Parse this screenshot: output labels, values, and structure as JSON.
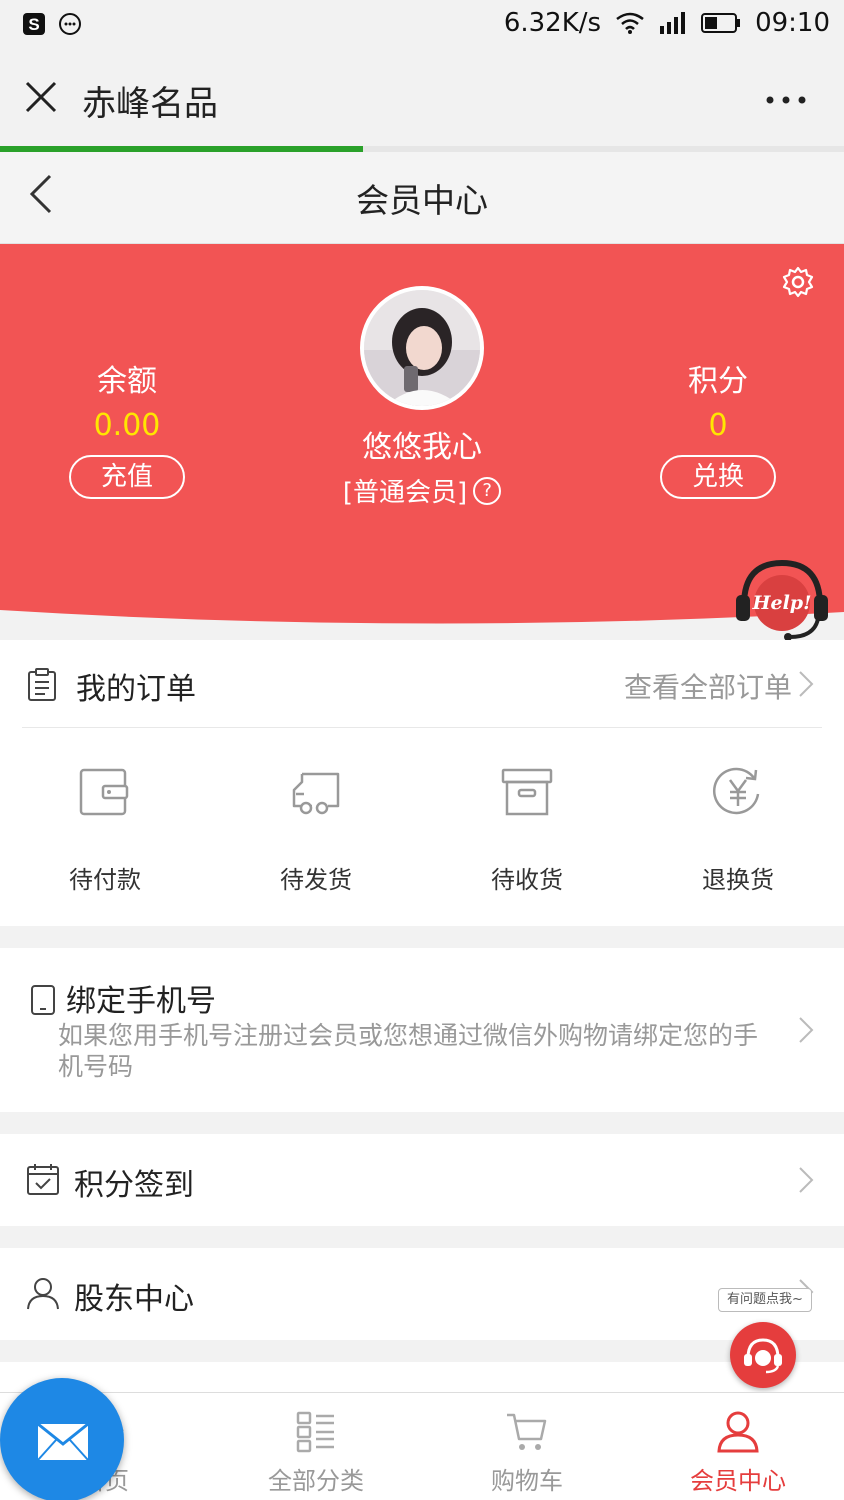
{
  "status_bar": {
    "speed": "6.32K/s",
    "time": "09:10"
  },
  "wechat": {
    "title": "赤峰名品",
    "load_progress": 0.43
  },
  "page": {
    "title": "会员中心"
  },
  "member": {
    "balance_label": "余额",
    "balance_value": "0.00",
    "recharge_label": "充值",
    "points_label": "积分",
    "points_value": "0",
    "exchange_label": "兑换",
    "username": "悠悠我心",
    "level": "[普通会员]",
    "help_badge": "Help!"
  },
  "orders": {
    "title": "我的订单",
    "view_all": "查看全部订单",
    "statuses": [
      {
        "label": "待付款",
        "icon": "wallet-icon"
      },
      {
        "label": "待发货",
        "icon": "truck-icon"
      },
      {
        "label": "待收货",
        "icon": "box-icon"
      },
      {
        "label": "退换货",
        "icon": "yen-refund-icon"
      }
    ]
  },
  "bind_phone": {
    "title": "绑定手机号",
    "desc": "如果您用手机号注册过会员或您想通过微信外购物请绑定您的手机号码"
  },
  "points_signin": {
    "title": "积分签到"
  },
  "shareholder": {
    "title": "股东中心"
  },
  "service_tip": "有问题点我~",
  "tabs": [
    {
      "label": "首页",
      "icon": "home-icon"
    },
    {
      "label": "全部分类",
      "icon": "category-icon"
    },
    {
      "label": "购物车",
      "icon": "cart-icon"
    },
    {
      "label": "会员中心",
      "icon": "user-icon",
      "active": true
    }
  ],
  "colors": {
    "brand_red": "#f25454",
    "accent_yellow": "#ffe600",
    "active_tab": "#e53d3d",
    "progress_green": "#2aa12a"
  }
}
